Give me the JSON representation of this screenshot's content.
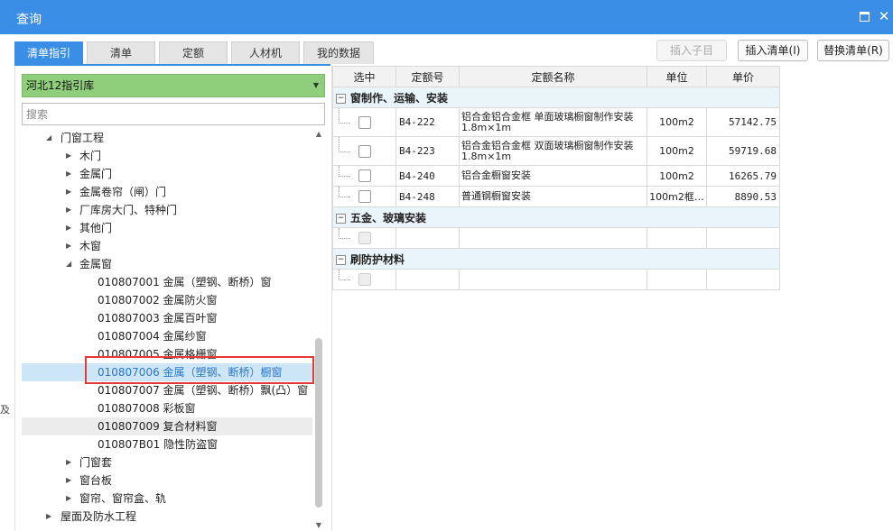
{
  "window": {
    "title": "查询"
  },
  "tabs": [
    {
      "label": "清单指引"
    },
    {
      "label": "清单"
    },
    {
      "label": "定额"
    },
    {
      "label": "人材机"
    },
    {
      "label": "我的数据"
    }
  ],
  "toolbar": {
    "insert_child": "插入子目",
    "insert_list": "插入清单(I)",
    "replace_list": "替换清单(R)"
  },
  "library": {
    "selected": "河北12指引库"
  },
  "search": {
    "placeholder": "搜索"
  },
  "tree": [
    {
      "label": "门窗工程"
    },
    {
      "label": "木门"
    },
    {
      "label": "金属门"
    },
    {
      "label": "金属卷帘（闸）门"
    },
    {
      "label": "厂库房大门、特种门"
    },
    {
      "label": "其他门"
    },
    {
      "label": "木窗"
    },
    {
      "label": "金属窗"
    },
    {
      "label": "010807001  金属（塑钢、断桥）窗"
    },
    {
      "label": "010807002  金属防火窗"
    },
    {
      "label": "010807003  金属百叶窗"
    },
    {
      "label": "010807004  金属纱窗"
    },
    {
      "label": "010807005  金属格栅窗"
    },
    {
      "label": "010807006  金属（塑钢、断桥）橱窗"
    },
    {
      "label": "010807007  金属（塑钢、断桥）飘(凸）窗"
    },
    {
      "label": "010807008  彩板窗"
    },
    {
      "label": "010807009  复合材料窗"
    },
    {
      "label": "010807B01  隐性防盗窗"
    },
    {
      "label": "门窗套"
    },
    {
      "label": "窗台板"
    },
    {
      "label": "窗帘、窗帘盒、轨"
    },
    {
      "label": "屋面及防水工程"
    }
  ],
  "table": {
    "headers": {
      "select": "选中",
      "code": "定额号",
      "name": "定额名称",
      "unit": "单位",
      "price": "单价"
    },
    "groups": [
      {
        "title": "窗制作、运输、安装",
        "rows": [
          {
            "code": "B4-222",
            "name": "铝合金铝合金框 单面玻璃橱窗制作安装 1.8m×1m",
            "unit": "100m2",
            "price": "57142.75"
          },
          {
            "code": "B4-223",
            "name": "铝合金铝合金框 双面玻璃橱窗制作安装 1.8m×1m",
            "unit": "100m2",
            "price": "59719.68"
          },
          {
            "code": "B4-240",
            "name": "铝合金橱窗安装",
            "unit": "100m2",
            "price": "16265.79"
          },
          {
            "code": "B4-248",
            "name": "普通钢橱窗安装",
            "unit": "100m2框…",
            "price": "8890.53"
          }
        ]
      },
      {
        "title": "五金、玻璃安装",
        "rows": []
      },
      {
        "title": "刷防护材料",
        "rows": []
      }
    ]
  },
  "edge_glyph": "及"
}
